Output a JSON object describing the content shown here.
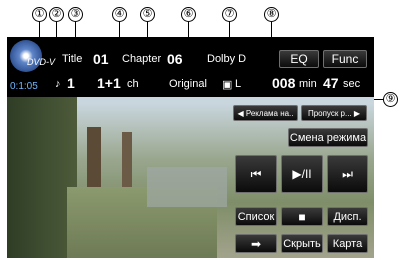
{
  "callouts": [
    "①",
    "②",
    "③",
    "④",
    "⑤",
    "⑥",
    "⑦",
    "⑧",
    "⑨"
  ],
  "status": {
    "disc_label": "DVD-V",
    "elapsed": "0:1:05",
    "title_label": "Title",
    "title_num": "01",
    "chapter_label": "Chapter",
    "chapter_num": "06",
    "audio_type": "Dolby D",
    "audio_track": "1",
    "channels": "1+1",
    "channels_unit": "ch",
    "aspect": "Original",
    "subtitle_lang": "L",
    "remain_min": "008",
    "min_unit": "min",
    "remain_sec": "47",
    "sec_unit": "sec"
  },
  "buttons": {
    "eq": "EQ",
    "func": "Func",
    "ad_prev": "◀ Реклама на..",
    "ad_skip": "Пропуск р... ▶",
    "mode_change": "Смена режима",
    "prev": "⏮",
    "play_pause": "▶/II",
    "next": "⏭",
    "list": "Список",
    "stop": "■",
    "display": "Дисп.",
    "arrow": "➡",
    "hide": "Скрыть",
    "map": "Карта"
  }
}
